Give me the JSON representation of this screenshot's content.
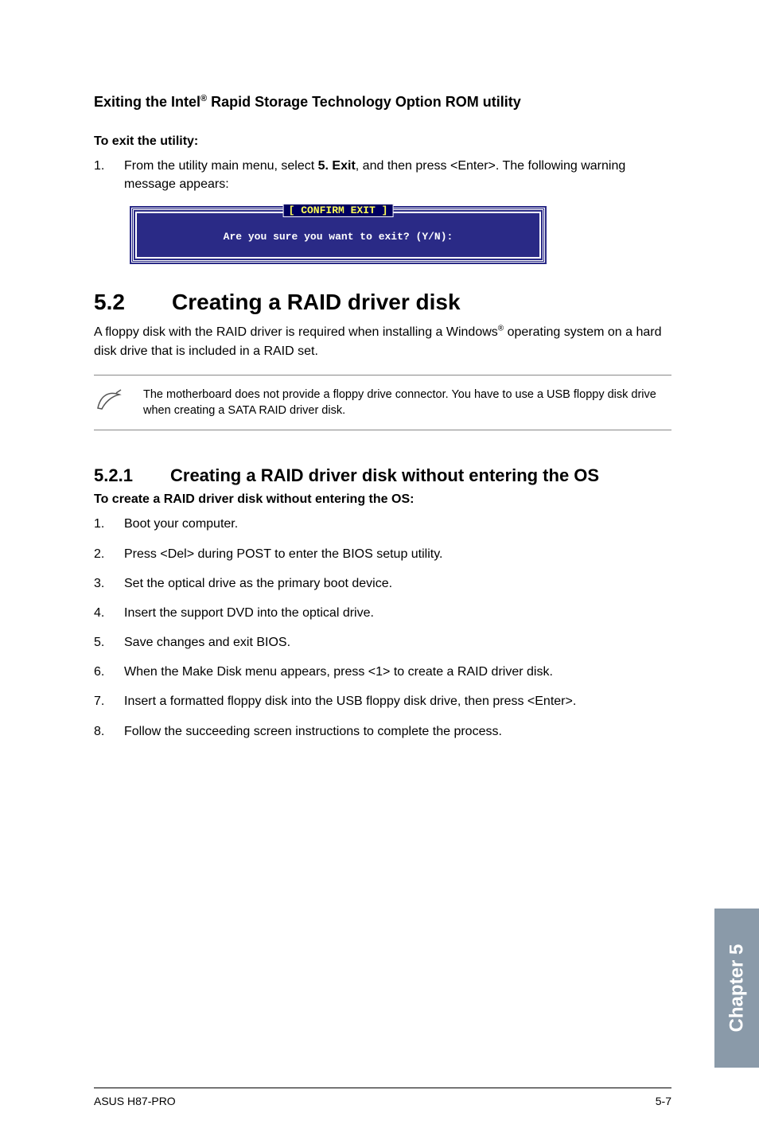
{
  "section_exit": {
    "heading_pre": "Exiting the Intel",
    "heading_sup": "®",
    "heading_post": " Rapid Storage Technology Option ROM utility",
    "para_bold": "To exit the utility:",
    "step_num": "1.",
    "step_pre": "From the utility main menu, select ",
    "step_bold": "5. Exit",
    "step_post": ", and then press <Enter>. The following warning message appears:"
  },
  "terminal": {
    "title": "[ CONFIRM EXIT ]",
    "text": "Are you sure you want to exit? (Y/N):"
  },
  "section_52": {
    "num": "5.2",
    "title": "Creating a RAID driver disk",
    "body_pre": "A floppy disk with the RAID driver is required when installing a Windows",
    "body_sup": "®",
    "body_post": " operating system on a hard disk drive that is included in a RAID set."
  },
  "note": {
    "text": "The motherboard does not provide a floppy drive connector. You have to use a USB floppy disk drive when creating a SATA RAID driver disk."
  },
  "section_521": {
    "num": "5.2.1",
    "title": "Creating a RAID driver disk without entering the OS",
    "para_bold": "To create a RAID driver disk without entering the OS:",
    "steps": [
      {
        "n": "1.",
        "t": "Boot your computer."
      },
      {
        "n": "2.",
        "t": "Press <Del> during POST to enter the BIOS setup utility."
      },
      {
        "n": "3.",
        "t": "Set the optical drive as the primary boot device."
      },
      {
        "n": "4.",
        "t": "Insert the support DVD into the optical drive."
      },
      {
        "n": "5.",
        "t": "Save changes and exit BIOS."
      },
      {
        "n": "6.",
        "t": "When the Make Disk menu appears, press <1> to create a RAID driver disk."
      },
      {
        "n": "7.",
        "t": "Insert a formatted floppy disk into the USB floppy disk drive, then press <Enter>."
      },
      {
        "n": "8.",
        "t": "Follow the succeeding screen instructions to complete the process."
      }
    ]
  },
  "chapter_tab": "Chapter 5",
  "footer": {
    "left": "ASUS H87-PRO",
    "right": "5-7"
  }
}
